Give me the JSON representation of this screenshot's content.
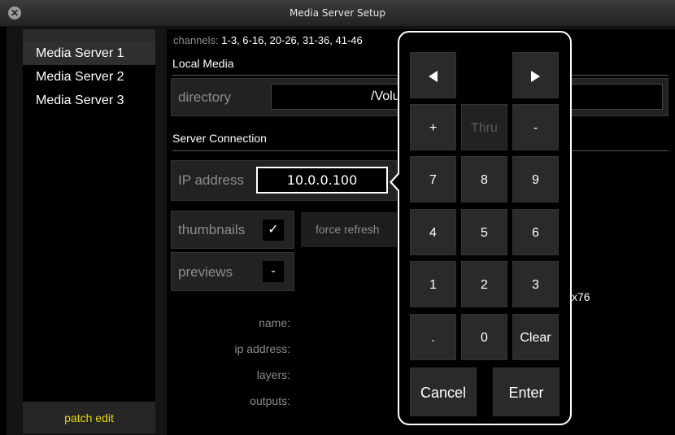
{
  "window": {
    "title": "Media Server Setup"
  },
  "sidebar": {
    "items": [
      {
        "label": "Media Server 1"
      },
      {
        "label": "Media Server 2"
      },
      {
        "label": "Media Server 3"
      }
    ],
    "patch_edit_label": "patch edit"
  },
  "main": {
    "channels_label": "channels:",
    "channels_value": "1-3, 6-16, 20-26, 31-36, 41-46",
    "local_media_heading": "Local Media",
    "directory_label": "directory",
    "directory_value": "/Volu",
    "server_connection_heading": "Server Connection",
    "ip_address_label": "IP address",
    "ip_address_value": "10.0.0.100",
    "thumbnails_label": "thumbnails",
    "thumbnails_check": "✓",
    "force_refresh_label": "force refresh",
    "previews_label": "previews",
    "previews_check": "-",
    "info": {
      "name_label": "name:",
      "ip_address_label": "ip address:",
      "layers_label": "layers:",
      "outputs_label": "outputs:",
      "resolution_fragment": "x76"
    }
  },
  "keypad": {
    "thru": "Thru",
    "plus": "+",
    "minus": "-",
    "digits": [
      "7",
      "8",
      "9",
      "4",
      "5",
      "6",
      "1",
      "2",
      "3"
    ],
    "dot": ".",
    "zero": "0",
    "clear": "Clear",
    "cancel": "Cancel",
    "enter": "Enter"
  }
}
